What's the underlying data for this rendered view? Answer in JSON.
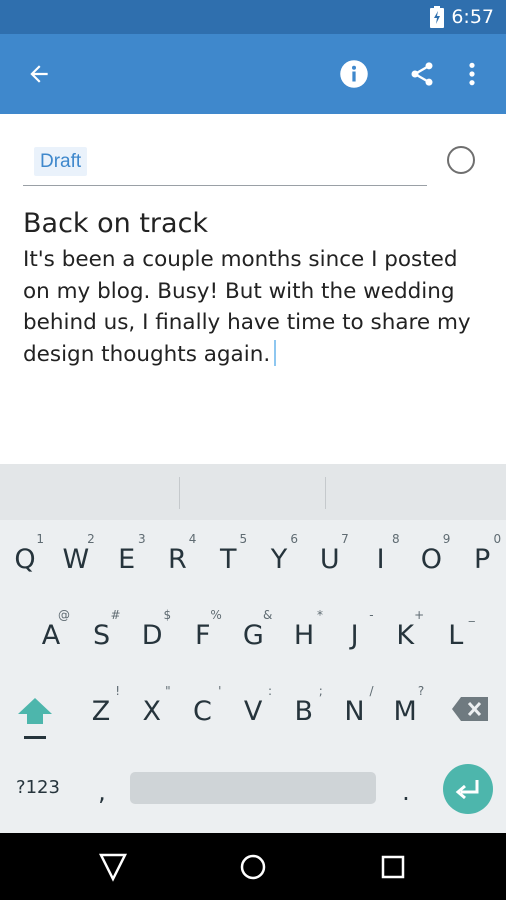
{
  "status_bar": {
    "time": "6:57",
    "battery_icon": "battery-charging-icon"
  },
  "app_bar": {
    "back_icon": "arrow-back-icon",
    "info_icon": "info-icon",
    "share_icon": "share-icon",
    "overflow_icon": "more-vert-icon",
    "color": "#3f88cc"
  },
  "editor": {
    "tag_chip": "Draft",
    "title": "Back on track",
    "body": "It's been a couple months since I posted on my blog. Busy! But with the wedding behind us, I finally have time to share my design thoughts again."
  },
  "keyboard": {
    "row1": [
      {
        "k": "Q",
        "s": "1"
      },
      {
        "k": "W",
        "s": "2"
      },
      {
        "k": "E",
        "s": "3"
      },
      {
        "k": "R",
        "s": "4"
      },
      {
        "k": "T",
        "s": "5"
      },
      {
        "k": "Y",
        "s": "6"
      },
      {
        "k": "U",
        "s": "7"
      },
      {
        "k": "I",
        "s": "8"
      },
      {
        "k": "O",
        "s": "9"
      },
      {
        "k": "P",
        "s": "0"
      }
    ],
    "row2": [
      {
        "k": "A",
        "s": "@"
      },
      {
        "k": "S",
        "s": "#"
      },
      {
        "k": "D",
        "s": "$"
      },
      {
        "k": "F",
        "s": "%"
      },
      {
        "k": "G",
        "s": "&"
      },
      {
        "k": "H",
        "s": "*"
      },
      {
        "k": "J",
        "s": "-"
      },
      {
        "k": "K",
        "s": "+"
      },
      {
        "k": "L",
        "s": "_"
      }
    ],
    "row3": [
      {
        "k": "Z",
        "s": "!"
      },
      {
        "k": "X",
        "s": "\""
      },
      {
        "k": "C",
        "s": "'"
      },
      {
        "k": "V",
        "s": ":"
      },
      {
        "k": "B",
        "s": ";"
      },
      {
        "k": "N",
        "s": "/"
      },
      {
        "k": "M",
        "s": "?"
      }
    ],
    "symbols_label": "?123",
    "comma": ",",
    "period": ".",
    "enter_color": "#4db6ac"
  },
  "nav_bar": {
    "back": "nav-back-icon",
    "home": "nav-home-icon",
    "recents": "nav-recents-icon"
  }
}
